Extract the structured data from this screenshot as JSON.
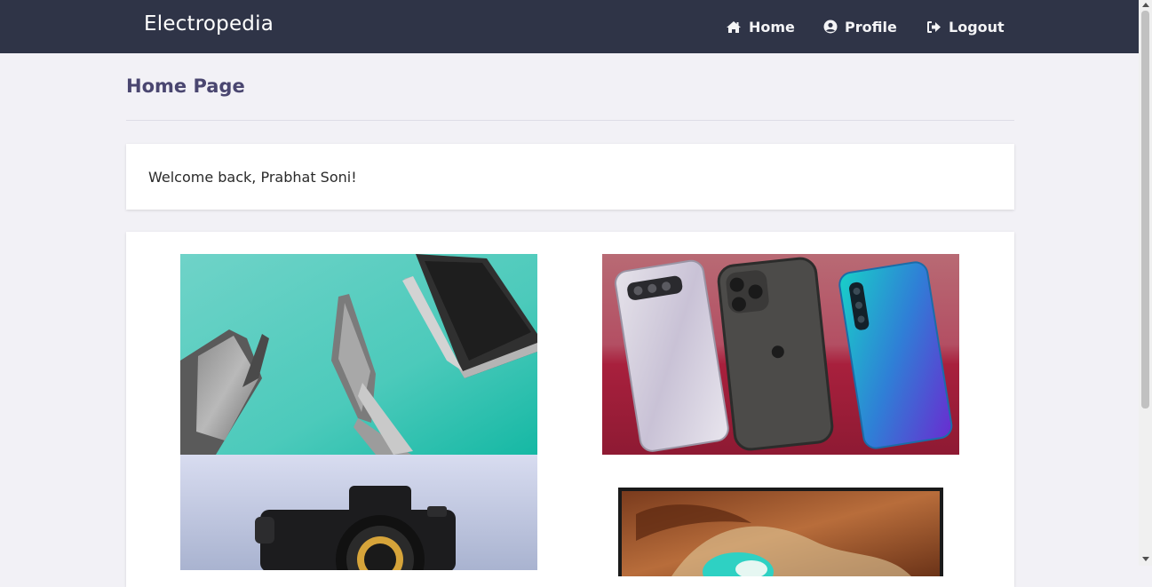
{
  "navbar": {
    "brand": "Electropedia",
    "items": [
      {
        "label": "Home",
        "icon": "home-icon"
      },
      {
        "label": "Profile",
        "icon": "user-circle-icon"
      },
      {
        "label": "Logout",
        "icon": "sign-out-icon"
      }
    ],
    "background": "#2f3447"
  },
  "page": {
    "title": "Home Page",
    "welcome": "Welcome back, Prabhat Soni!",
    "title_color": "#4a4670"
  },
  "gallery": {
    "tiles": [
      {
        "subject": "laptops"
      },
      {
        "subject": "smartphones"
      },
      {
        "subject": "camera"
      },
      {
        "subject": "television"
      }
    ]
  }
}
